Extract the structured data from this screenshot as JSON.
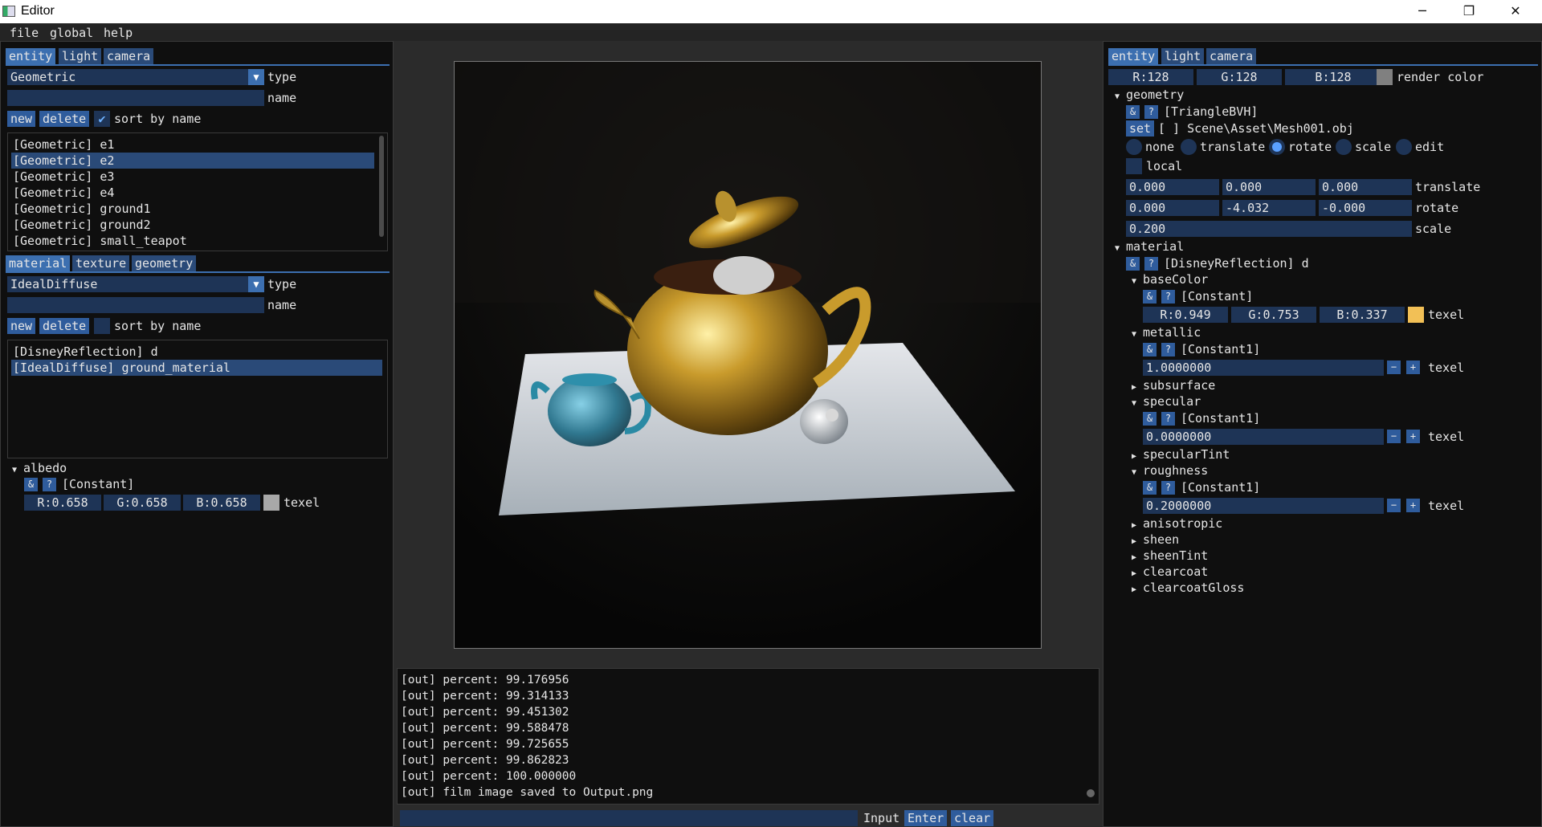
{
  "window": {
    "title": "Editor",
    "minimize": "─",
    "maximize": "❐",
    "close": "✕"
  },
  "menu": [
    "file",
    "global",
    "help"
  ],
  "left": {
    "tabs": [
      "entity",
      "light",
      "camera"
    ],
    "type_value": "Geometric",
    "type_label": "type",
    "name_value": "",
    "name_label": "name",
    "new_label": "new",
    "delete_label": "delete",
    "sort_label": "sort by name",
    "sort_checked": true,
    "entities": [
      "[Geometric] e1",
      "[Geometric] e2",
      "[Geometric] e3",
      "[Geometric] e4",
      "[Geometric] ground1",
      "[Geometric] ground2",
      "[Geometric] small_teapot"
    ],
    "selected_entity_index": 1,
    "sub_tabs": [
      "material",
      "texture",
      "geometry"
    ],
    "mat_type_value": "IdealDiffuse",
    "mat_type_label": "type",
    "mat_name_value": "",
    "mat_name_label": "name",
    "mat_new_label": "new",
    "mat_delete_label": "delete",
    "mat_sort_label": "sort by name",
    "mat_sort_checked": false,
    "materials": [
      "[DisneyReflection] d",
      "[IdealDiffuse] ground_material"
    ],
    "selected_material_index": 1,
    "albedo": {
      "label": "albedo",
      "amp": "&",
      "q": "?",
      "type": "[Constant]",
      "r": "R:0.658",
      "g": "G:0.658",
      "b": "B:0.658",
      "color": "#a8a8a8",
      "texel": "texel"
    }
  },
  "right": {
    "tabs": [
      "entity",
      "light",
      "camera"
    ],
    "render_color": {
      "r": "R:128",
      "g": "G:128",
      "b": "B:128",
      "label": "render color",
      "color": "#808080"
    },
    "geometry": {
      "label": "geometry",
      "amp": "&",
      "q": "?",
      "type": "[TriangleBVH]",
      "set_label": "set",
      "path": "[ ] Scene\\Asset\\Mesh001.obj",
      "modes": [
        "none",
        "translate",
        "rotate",
        "scale",
        "edit"
      ],
      "selected_mode": 2,
      "local_label": "local",
      "translate": [
        "0.000",
        "0.000",
        "0.000"
      ],
      "translate_label": "translate",
      "rotate": [
        "0.000",
        "-4.032",
        "-0.000"
      ],
      "rotate_label": "rotate",
      "scale": "0.200",
      "scale_label": "scale"
    },
    "material": {
      "label": "material",
      "amp": "&",
      "q": "?",
      "type": "[DisneyReflection] d",
      "baseColor": {
        "label": "baseColor",
        "type": "[Constant]",
        "r": "R:0.949",
        "g": "G:0.753",
        "b": "B:0.337",
        "color": "#f2c056",
        "texel": "texel"
      },
      "metallic": {
        "label": "metallic",
        "type": "[Constant1]",
        "value": "1.0000000",
        "minus": "−",
        "plus": "+",
        "texel": "texel"
      },
      "subsurface": "subsurface",
      "specular": {
        "label": "specular",
        "type": "[Constant1]",
        "value": "0.0000000",
        "minus": "−",
        "plus": "+",
        "texel": "texel"
      },
      "specularTint": "specularTint",
      "roughness": {
        "label": "roughness",
        "type": "[Constant1]",
        "value": "0.2000000",
        "minus": "−",
        "plus": "+",
        "texel": "texel"
      },
      "collapsed": [
        "anisotropic",
        "sheen",
        "sheenTint",
        "clearcoat",
        "clearcoatGloss"
      ]
    }
  },
  "console": {
    "lines": [
      "[out] percent: 99.176956",
      "[out] percent: 99.314133",
      "[out] percent: 99.451302",
      "[out] percent: 99.588478",
      "[out] percent: 99.725655",
      "[out] percent: 99.862823",
      "[out] percent: 100.000000",
      "[out] film image saved to Output.png"
    ],
    "input_value": "",
    "input_label": "Input",
    "enter_label": "Enter",
    "clear_label": "clear"
  }
}
